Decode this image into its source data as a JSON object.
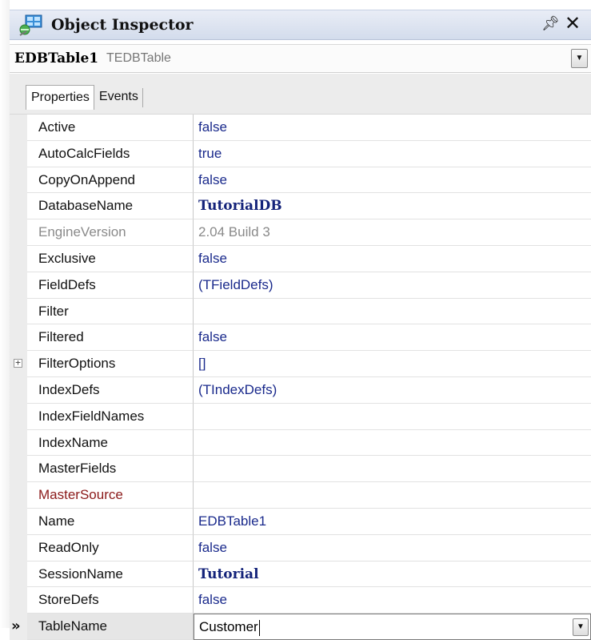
{
  "window": {
    "title": "Object Inspector"
  },
  "object_selector": {
    "name": "EDBTable1",
    "type": "TEDBTable"
  },
  "tabs": [
    {
      "label": "Properties"
    },
    {
      "label": "Events"
    }
  ],
  "properties": [
    {
      "name": "Active",
      "value": "false"
    },
    {
      "name": "AutoCalcFields",
      "value": "true"
    },
    {
      "name": "CopyOnAppend",
      "value": "false"
    },
    {
      "name": "DatabaseName",
      "value": "TutorialDB"
    },
    {
      "name": "EngineVersion",
      "value": "2.04 Build 3"
    },
    {
      "name": "Exclusive",
      "value": "false"
    },
    {
      "name": "FieldDefs",
      "value": "(TFieldDefs)"
    },
    {
      "name": "Filter",
      "value": ""
    },
    {
      "name": "Filtered",
      "value": "false"
    },
    {
      "name": "FilterOptions",
      "value": "[]"
    },
    {
      "name": "IndexDefs",
      "value": "(TIndexDefs)"
    },
    {
      "name": "IndexFieldNames",
      "value": ""
    },
    {
      "name": "IndexName",
      "value": ""
    },
    {
      "name": "MasterFields",
      "value": ""
    },
    {
      "name": "MasterSource",
      "value": ""
    },
    {
      "name": "Name",
      "value": "EDBTable1"
    },
    {
      "name": "ReadOnly",
      "value": "false"
    },
    {
      "name": "SessionName",
      "value": "Tutorial"
    },
    {
      "name": "StoreDefs",
      "value": "false"
    },
    {
      "name": "TableName",
      "value": "Customer"
    }
  ],
  "icons": {
    "title": "component-palette-icon",
    "pin": "pin-icon",
    "close": "close-icon",
    "expand": "expand-plus-icon",
    "current_row": "double-chevron-right-icon",
    "dropdown": "chevron-down-icon"
  },
  "colors": {
    "value_text": "#1a2a8c",
    "readonly_text": "#8a8a8a",
    "link_property": "#8b1a1a",
    "titlebar": "#d3dcec"
  }
}
